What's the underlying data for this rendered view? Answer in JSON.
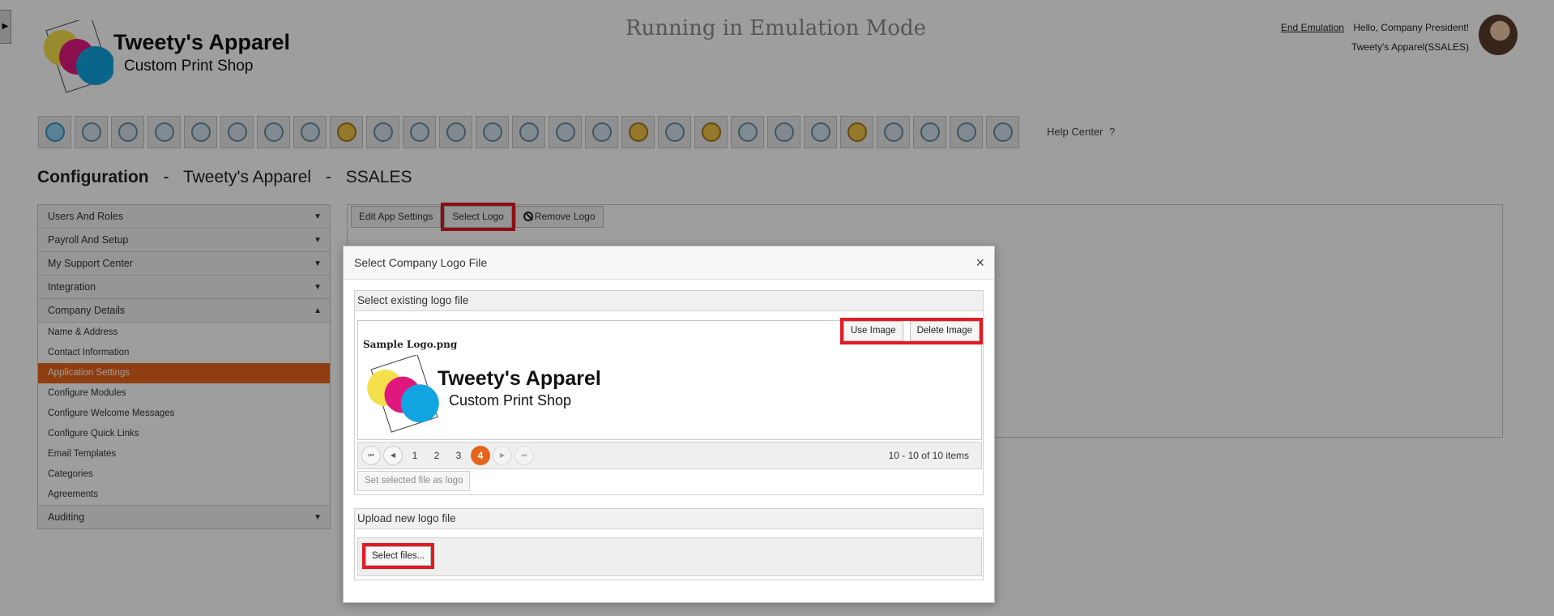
{
  "sidebar_toggle": {
    "icon": "triangle-right-icon",
    "glyph": "▶"
  },
  "logo": {
    "title": "Tweety's Apparel",
    "subtitle": "Custom Print Shop"
  },
  "banner": "Running in Emulation Mode",
  "user": {
    "end_emulation": "End Emulation",
    "greeting": "Hello, Company President!",
    "company": "Tweety's Apparel(SSALES)"
  },
  "toolbar": {
    "icons": [
      "home-icon",
      "award-icon",
      "people-settings-icon",
      "presenter-icon",
      "group-icon",
      "team-icon",
      "org-chart-icon",
      "document-icon",
      "money-bag-icon",
      "target-icon",
      "target-arrows-icon",
      "target-gear-icon",
      "target-person-icon",
      "person-down-icon",
      "person-chart-icon",
      "shield-person-icon",
      "money-hand-icon",
      "person-x-icon",
      "money-bag-2-icon",
      "team-chart-icon",
      "person-star-icon",
      "coins-team-icon",
      "money-hand-2-icon",
      "gift-icon",
      "report-icon",
      "team-board-icon",
      "person-gear-icon"
    ],
    "help_label": "Help Center",
    "help_icon": "?"
  },
  "config": {
    "label": "Configuration",
    "sep": "-",
    "company": "Tweety's Apparel",
    "code": "SSALES"
  },
  "nav": {
    "sections": [
      {
        "label": "Users And Roles",
        "arrow": "▼"
      },
      {
        "label": "Payroll And Setup",
        "arrow": "▼"
      },
      {
        "label": "My Support Center",
        "arrow": "▼"
      },
      {
        "label": "Integration",
        "arrow": "▼"
      },
      {
        "label": "Company Details",
        "arrow": "▲"
      }
    ],
    "items": [
      {
        "label": "Name & Address"
      },
      {
        "label": "Contact Information"
      },
      {
        "label": "Application Settings"
      },
      {
        "label": "Configure Modules"
      },
      {
        "label": "Configure Welcome Messages"
      },
      {
        "label": "Configure Quick Links"
      },
      {
        "label": "Email Templates"
      },
      {
        "label": "Categories"
      },
      {
        "label": "Agreements"
      }
    ],
    "last_section": {
      "label": "Auditing",
      "arrow": "▼"
    }
  },
  "tabs": {
    "edit": "Edit App Settings",
    "select": "Select Logo",
    "remove": "Remove Logo",
    "remove_icon": "⃠"
  },
  "modal": {
    "title": "Select Company Logo File",
    "close": "×",
    "existing": {
      "heading": "Select existing logo file",
      "use_image": "Use Image",
      "delete_image": "Delete Image",
      "file_name": "Sample Logo.png",
      "preview_title": "Tweety's Apparel",
      "preview_subtitle": "Custom Print Shop",
      "pager": {
        "first": "⏮",
        "prev": "◀",
        "next": "▶",
        "last": "⏭",
        "pages": [
          "1",
          "2",
          "3",
          "4"
        ],
        "current": "4",
        "info": "10 - 10 of 10 items"
      },
      "set_selected": "Set selected file as logo"
    },
    "upload": {
      "heading": "Upload new logo file",
      "select_files": "Select files..."
    }
  },
  "colors": {
    "accent": "#e5641b",
    "highlight": "#e01b24"
  }
}
